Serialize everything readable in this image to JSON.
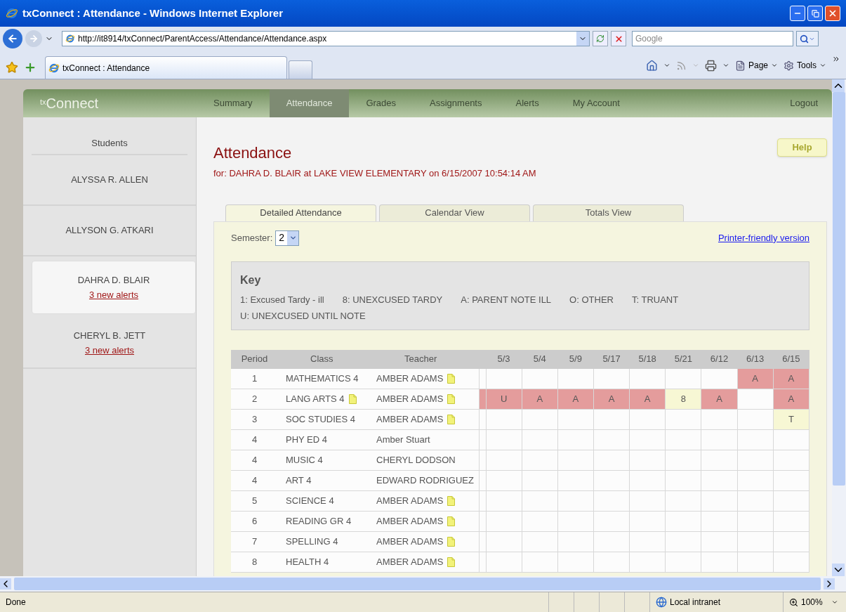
{
  "window": {
    "title": "txConnect : Attendance - Windows Internet Explorer"
  },
  "address_bar": {
    "url": "http://it8914/txConnect/ParentAccess/Attendance/Attendance.aspx"
  },
  "search": {
    "placeholder": "Google"
  },
  "browser_tabs": [
    {
      "label": "txConnect : Attendance",
      "selected": true
    }
  ],
  "command_bar": [
    "Page",
    "Tools"
  ],
  "site": {
    "logo": "$^{tx}$Connect",
    "nav": [
      {
        "label": "Summary",
        "selected": false
      },
      {
        "label": "Attendance",
        "selected": true
      },
      {
        "label": "Grades",
        "selected": false
      },
      {
        "label": "Assignments",
        "selected": false
      },
      {
        "label": "Alerts",
        "selected": false
      },
      {
        "label": "My Account",
        "selected": false
      }
    ],
    "logout": "Logout"
  },
  "sidebar": {
    "heading": "Students",
    "students": [
      {
        "name": "ALYSSA R. ALLEN",
        "selected": false
      },
      {
        "name": "ALLYSON G. ATKARI",
        "selected": false
      },
      {
        "name": "DAHRA D. BLAIR",
        "alerts": "3 new alerts",
        "selected": true
      },
      {
        "name": "CHERYL B. JETT",
        "alerts": "3 new alerts",
        "selected": false
      }
    ]
  },
  "page": {
    "title": "Attendance",
    "subtitle": "for: DAHRA D. BLAIR at LAKE VIEW ELEMENTARY on 6/15/2007 10:54:14 AM",
    "help": "Help",
    "tabs": [
      {
        "label": "Detailed Attendance",
        "selected": true
      },
      {
        "label": "Calendar View",
        "selected": false
      },
      {
        "label": "Totals View",
        "selected": false
      }
    ],
    "semester": {
      "label": "Semester:",
      "value": "2"
    },
    "printer_link": "Printer-friendly version",
    "key": {
      "title": "Key",
      "items": [
        "1: Excused Tardy - ill",
        "8: UNEXCUSED TARDY",
        "A: PARENT NOTE ILL",
        "O: OTHER",
        "T: TRUANT",
        "U: UNEXCUSED UNTIL NOTE"
      ]
    },
    "table": {
      "columns": [
        "Period",
        "Class",
        "Teacher"
      ],
      "dates": [
        "5/3",
        "5/4",
        "5/9",
        "5/17",
        "5/18",
        "5/21",
        "6/12",
        "6/13",
        "6/15"
      ],
      "rows": [
        {
          "period": "1",
          "class": "MATHEMATICS 4",
          "class_note": false,
          "teacher": "AMBER ADAMS",
          "teacher_note": true,
          "marks": [
            {
              "kind": "blank"
            },
            {
              "kind": "blank"
            },
            {
              "kind": "blank"
            },
            {
              "kind": "blank"
            },
            {
              "kind": "blank"
            },
            {
              "kind": "blank"
            },
            {
              "kind": "blank"
            },
            {
              "kind": "mark",
              "code": "A",
              "color": "#e49c9c"
            },
            {
              "kind": "mark",
              "code": "A",
              "color": "#e49c9c"
            }
          ]
        },
        {
          "period": "2",
          "class": "LANG ARTS 4",
          "class_note": true,
          "teacher": "AMBER ADAMS",
          "teacher_note": true,
          "marks": [
            {
              "kind": "mark",
              "code": "U",
              "color": "#e49c9c"
            },
            {
              "kind": "mark",
              "code": "A",
              "color": "#e49c9c"
            },
            {
              "kind": "mark",
              "code": "A",
              "color": "#e49c9c"
            },
            {
              "kind": "mark",
              "code": "A",
              "color": "#e49c9c"
            },
            {
              "kind": "mark",
              "code": "A",
              "color": "#e49c9c"
            },
            {
              "kind": "mark",
              "code": "8",
              "color": "#f7f7d4"
            },
            {
              "kind": "mark",
              "code": "A",
              "color": "#e49c9c"
            },
            {
              "kind": "blank"
            },
            {
              "kind": "mark",
              "code": "A",
              "color": "#e49c9c"
            }
          ]
        },
        {
          "period": "3",
          "class": "SOC STUDIES 4",
          "class_note": false,
          "teacher": "AMBER ADAMS",
          "teacher_note": true,
          "marks": [
            {
              "kind": "blank"
            },
            {
              "kind": "blank"
            },
            {
              "kind": "blank"
            },
            {
              "kind": "blank"
            },
            {
              "kind": "blank"
            },
            {
              "kind": "blank"
            },
            {
              "kind": "blank"
            },
            {
              "kind": "blank"
            },
            {
              "kind": "mark",
              "code": "T",
              "color": "#f7f7d4"
            }
          ]
        },
        {
          "period": "4",
          "class": "PHY ED 4",
          "class_note": false,
          "teacher": "Amber Stuart",
          "teacher_note": false,
          "marks": [
            {
              "kind": "blank"
            },
            {
              "kind": "blank"
            },
            {
              "kind": "blank"
            },
            {
              "kind": "blank"
            },
            {
              "kind": "blank"
            },
            {
              "kind": "blank"
            },
            {
              "kind": "blank"
            },
            {
              "kind": "blank"
            },
            {
              "kind": "blank"
            }
          ]
        },
        {
          "period": "4",
          "class": "MUSIC 4",
          "class_note": false,
          "teacher": "CHERYL DODSON",
          "teacher_note": false,
          "marks": [
            {
              "kind": "blank"
            },
            {
              "kind": "blank"
            },
            {
              "kind": "blank"
            },
            {
              "kind": "blank"
            },
            {
              "kind": "blank"
            },
            {
              "kind": "blank"
            },
            {
              "kind": "blank"
            },
            {
              "kind": "blank"
            },
            {
              "kind": "blank"
            }
          ]
        },
        {
          "period": "4",
          "class": "ART 4",
          "class_note": false,
          "teacher": "EDWARD RODRIGUEZ",
          "teacher_note": false,
          "marks": [
            {
              "kind": "blank"
            },
            {
              "kind": "blank"
            },
            {
              "kind": "blank"
            },
            {
              "kind": "blank"
            },
            {
              "kind": "blank"
            },
            {
              "kind": "blank"
            },
            {
              "kind": "blank"
            },
            {
              "kind": "blank"
            },
            {
              "kind": "blank"
            }
          ]
        },
        {
          "period": "5",
          "class": "SCIENCE 4",
          "class_note": false,
          "teacher": "AMBER ADAMS",
          "teacher_note": true,
          "marks": [
            {
              "kind": "blank"
            },
            {
              "kind": "blank"
            },
            {
              "kind": "blank"
            },
            {
              "kind": "blank"
            },
            {
              "kind": "blank"
            },
            {
              "kind": "blank"
            },
            {
              "kind": "blank"
            },
            {
              "kind": "blank"
            },
            {
              "kind": "blank"
            }
          ]
        },
        {
          "period": "6",
          "class": "READING GR 4",
          "class_note": false,
          "teacher": "AMBER ADAMS",
          "teacher_note": true,
          "marks": [
            {
              "kind": "blank"
            },
            {
              "kind": "blank"
            },
            {
              "kind": "blank"
            },
            {
              "kind": "blank"
            },
            {
              "kind": "blank"
            },
            {
              "kind": "blank"
            },
            {
              "kind": "blank"
            },
            {
              "kind": "blank"
            },
            {
              "kind": "blank"
            }
          ]
        },
        {
          "period": "7",
          "class": "SPELLING 4",
          "class_note": false,
          "teacher": "AMBER ADAMS",
          "teacher_note": true,
          "marks": [
            {
              "kind": "blank"
            },
            {
              "kind": "blank"
            },
            {
              "kind": "blank"
            },
            {
              "kind": "blank"
            },
            {
              "kind": "blank"
            },
            {
              "kind": "blank"
            },
            {
              "kind": "blank"
            },
            {
              "kind": "blank"
            },
            {
              "kind": "blank"
            }
          ]
        },
        {
          "period": "8",
          "class": "HEALTH 4",
          "class_note": false,
          "teacher": "AMBER ADAMS",
          "teacher_note": true,
          "marks": [
            {
              "kind": "blank"
            },
            {
              "kind": "blank"
            },
            {
              "kind": "blank"
            },
            {
              "kind": "blank"
            },
            {
              "kind": "blank"
            },
            {
              "kind": "blank"
            },
            {
              "kind": "blank"
            },
            {
              "kind": "blank"
            },
            {
              "kind": "blank"
            }
          ]
        }
      ]
    }
  },
  "status_bar": {
    "text": "Done",
    "zone": "Local intranet",
    "zoom": "100%"
  }
}
